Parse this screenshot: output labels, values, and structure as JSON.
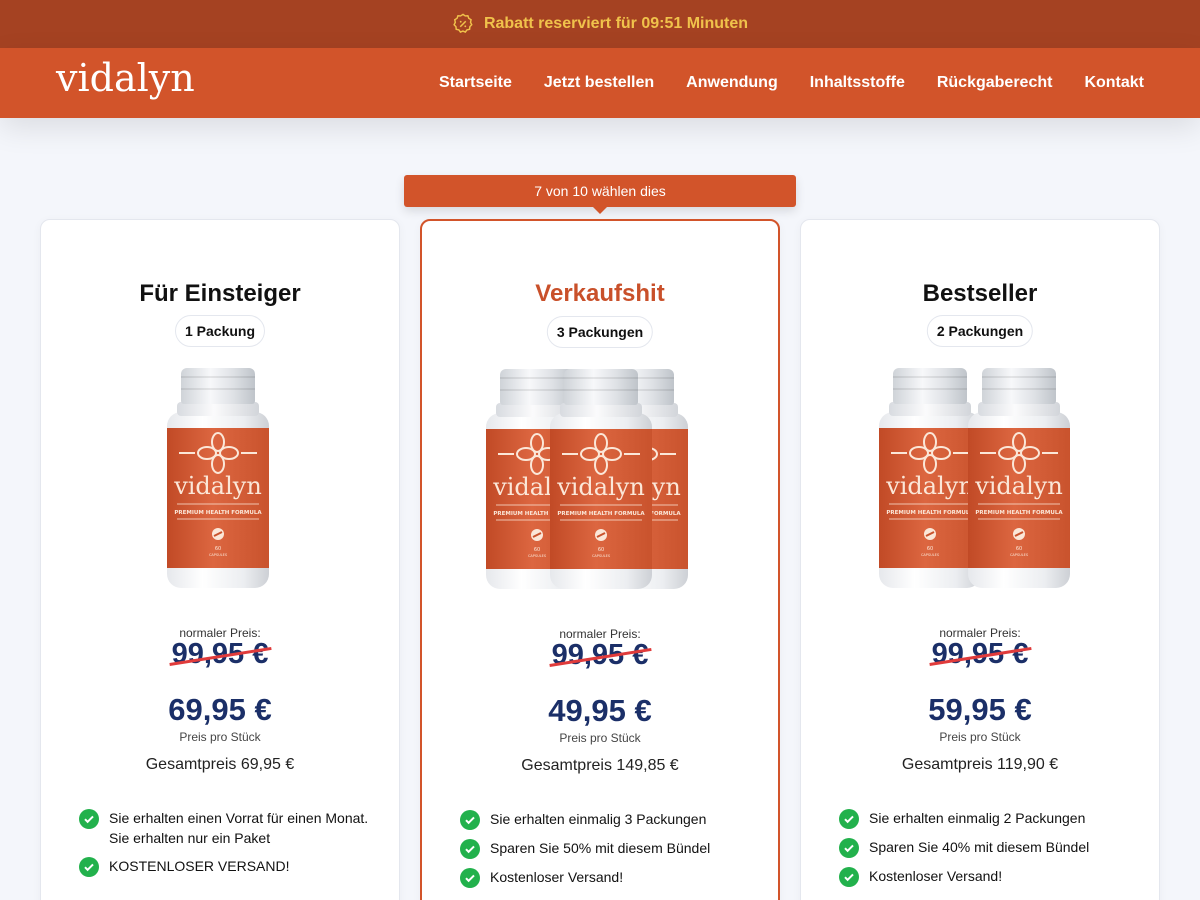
{
  "topbar": {
    "message": "Rabatt reserviert für 09:51 Minuten",
    "icon": "discount-badge-icon"
  },
  "nav": {
    "logo": "vidalyn",
    "items": [
      {
        "label": "Startseite"
      },
      {
        "label": "Jetzt bestellen"
      },
      {
        "label": "Anwendung"
      },
      {
        "label": "Inhaltsstoffe"
      },
      {
        "label": "Rückgaberecht"
      },
      {
        "label": "Kontakt"
      }
    ]
  },
  "popular_tag": "7 von 10 wählen dies",
  "colors": {
    "brand": "#d2542a",
    "dark_brand": "#a54222",
    "price": "#1b2f68",
    "check": "#22b14c",
    "strike": "#e03b3b"
  },
  "plans": [
    {
      "title": "Für Einsteiger",
      "packs": "1 Packung",
      "bottle_count": 1,
      "regular_label": "normaler Preis:",
      "old_price": "99,95 €",
      "price": "69,95 €",
      "unit_label": "Preis pro Stück",
      "total": "Gesamtpreis 69,95 €",
      "features": [
        "Sie erhalten einen Vorrat für einen Monat. Sie erhalten nur ein Paket",
        "KOSTENLOSER VERSAND!"
      ]
    },
    {
      "title": "Verkaufshit",
      "packs": "3 Packungen",
      "bottle_count": 3,
      "regular_label": "normaler Preis:",
      "old_price": "99,95 €",
      "price": "49,95 €",
      "unit_label": "Preis pro Stück",
      "total": "Gesamtpreis 149,85 €",
      "features": [
        "Sie erhalten einmalig 3 Packungen",
        "Sparen Sie 50% mit diesem Bündel",
        "Kostenloser Versand!"
      ]
    },
    {
      "title": "Bestseller",
      "packs": "2 Packungen",
      "bottle_count": 2,
      "regular_label": "normaler Preis:",
      "old_price": "99,95 €",
      "price": "59,95 €",
      "unit_label": "Preis pro Stück",
      "total": "Gesamtpreis 119,90 €",
      "features": [
        "Sie erhalten einmalig 2 Packungen",
        "Sparen Sie 40% mit diesem Bündel",
        "Kostenloser Versand!"
      ]
    }
  ],
  "bottle_label": {
    "brand": "vidalyn",
    "tagline": "PREMIUM HEALTH FORMULA",
    "count": "60",
    "unit": "CAPSULES"
  }
}
